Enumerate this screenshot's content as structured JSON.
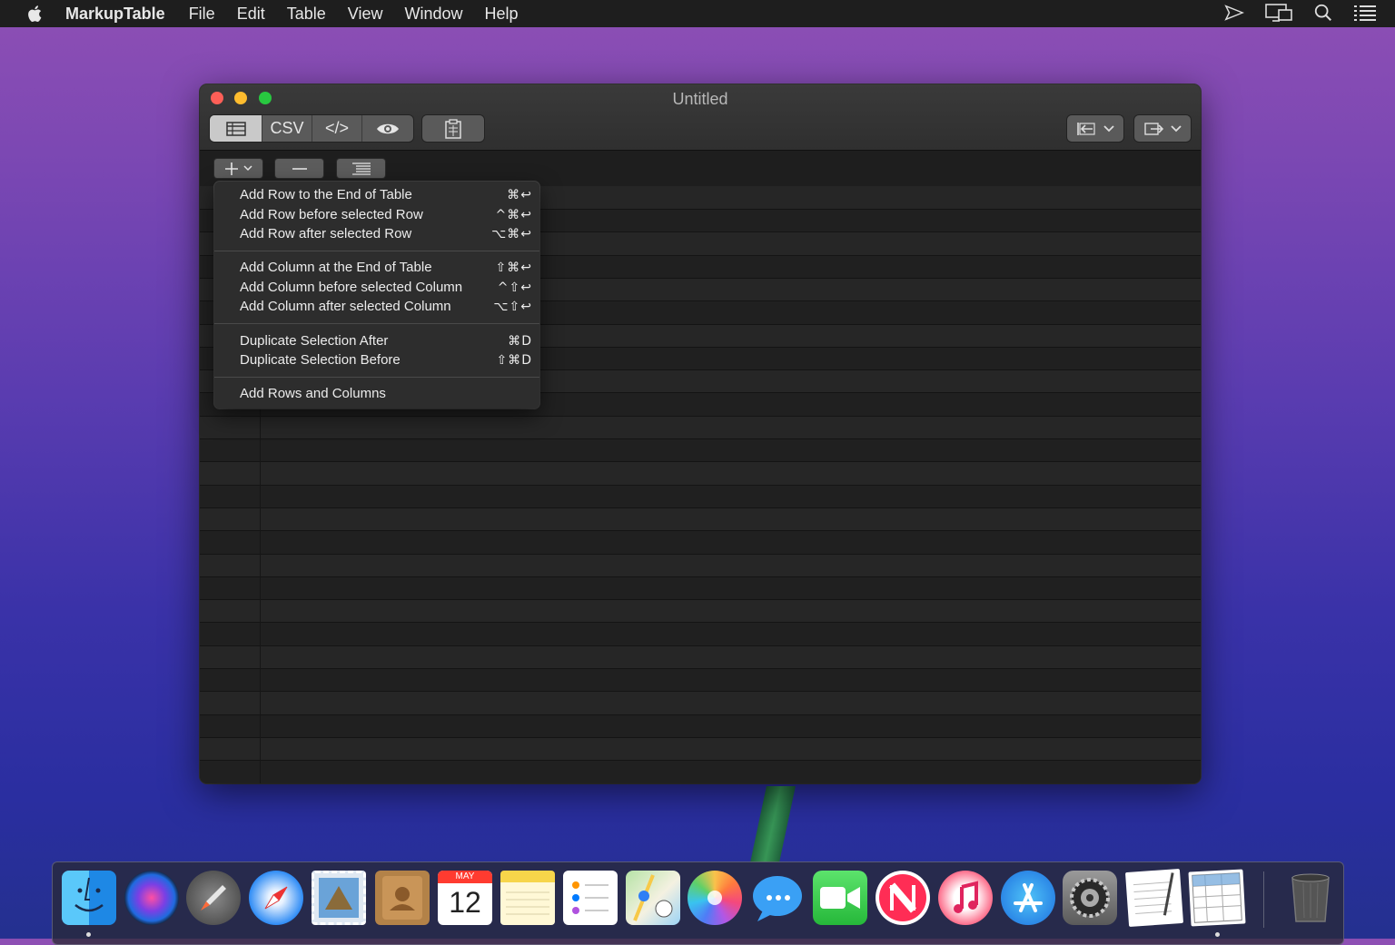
{
  "menubar": {
    "app_name": "MarkupTable",
    "items": [
      "File",
      "Edit",
      "Table",
      "View",
      "Window",
      "Help"
    ]
  },
  "window": {
    "title": "Untitled",
    "toolbar": {
      "segments": [
        "table-view",
        "CSV",
        "</>",
        "preview"
      ],
      "csv_label": "CSV",
      "code_label": "</>"
    }
  },
  "add_menu": {
    "groups": [
      [
        {
          "label": "Add Row to the End of Table",
          "shortcut": "⌘↩"
        },
        {
          "label": "Add Row before selected Row",
          "shortcut": "^⌘↩"
        },
        {
          "label": "Add Row after selected Row",
          "shortcut": "⌥⌘↩"
        }
      ],
      [
        {
          "label": "Add Column at the End of Table",
          "shortcut": "⇧⌘↩"
        },
        {
          "label": "Add Column before selected Column",
          "shortcut": "^⇧↩"
        },
        {
          "label": "Add Column after selected Column",
          "shortcut": "⌥⇧↩"
        }
      ],
      [
        {
          "label": "Duplicate Selection After",
          "shortcut": "⌘D"
        },
        {
          "label": "Duplicate Selection Before",
          "shortcut": "⇧⌘D"
        }
      ],
      [
        {
          "label": "Add Rows and Columns",
          "shortcut": ""
        }
      ]
    ]
  },
  "dock": {
    "apps": [
      "finder-icon",
      "siri-icon",
      "launchpad-icon",
      "safari-icon",
      "mail-icon",
      "contacts-icon",
      "calendar-icon",
      "notes-icon",
      "reminders-icon",
      "maps-icon",
      "photos-icon",
      "messages-icon",
      "facetime-icon",
      "news-icon",
      "music-icon",
      "app-store-icon",
      "system-preferences-icon",
      "textedit-icon",
      "markuptable-icon",
      "trash-icon"
    ],
    "calendar": {
      "month": "MAY",
      "day": "12"
    }
  }
}
